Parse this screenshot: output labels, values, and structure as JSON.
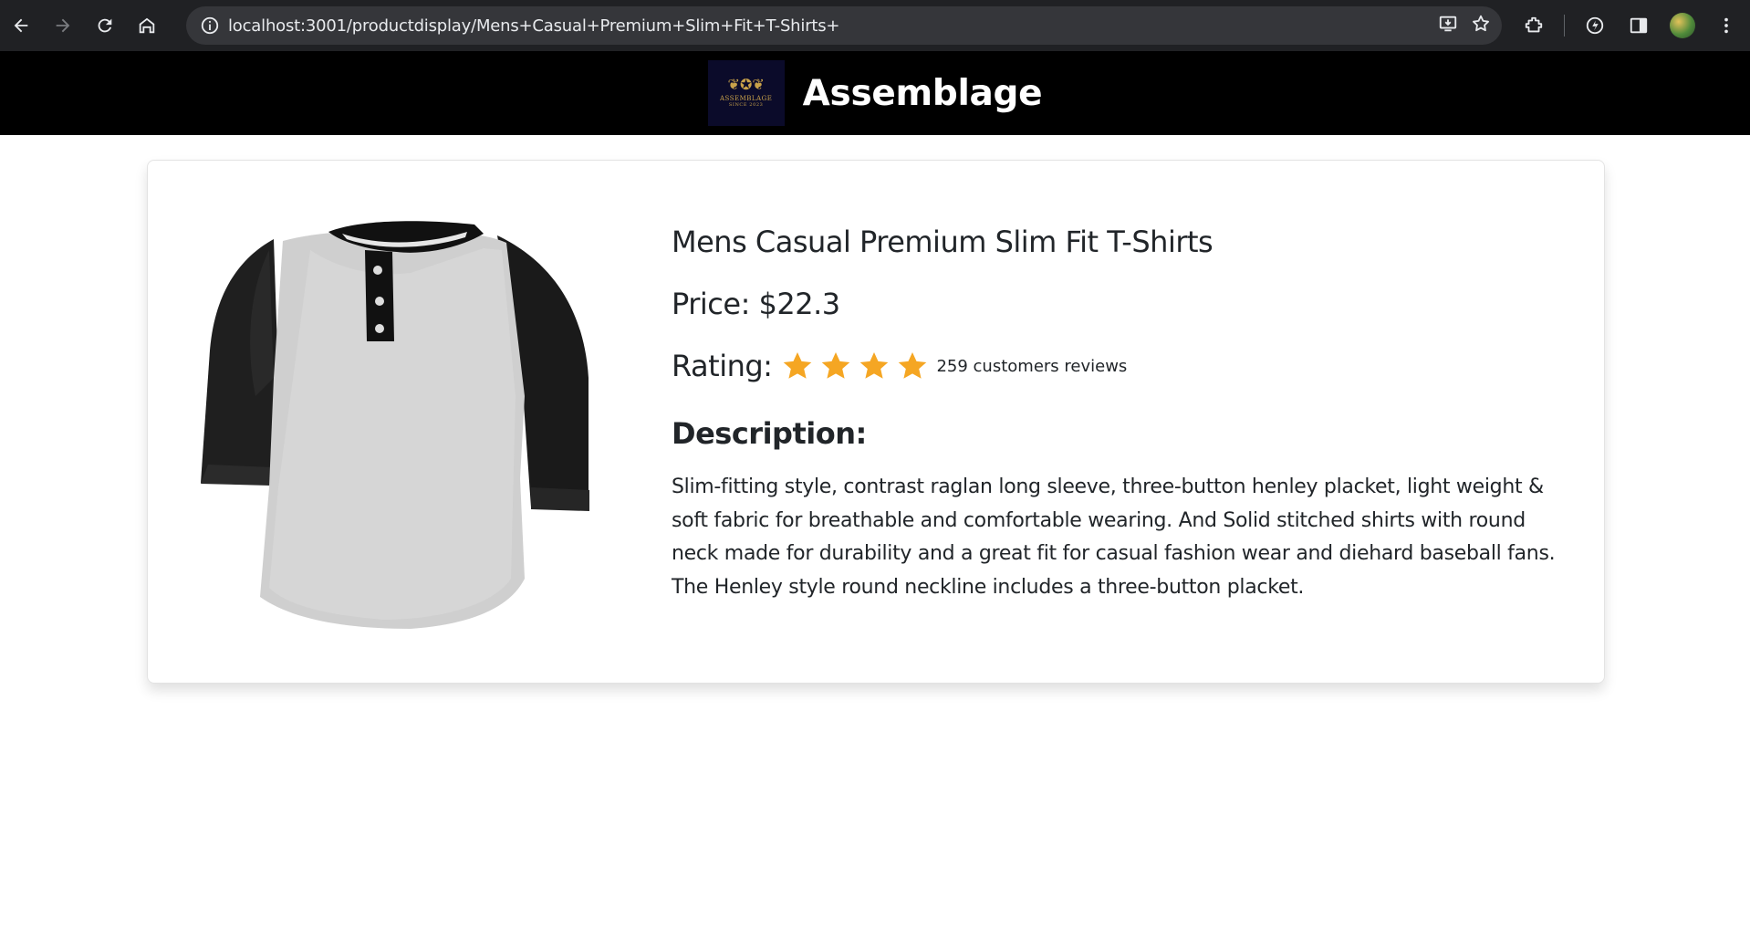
{
  "browser": {
    "url": "localhost:3001/productdisplay/Mens+Casual+Premium+Slim+Fit+T-Shirts+"
  },
  "header": {
    "brand_name": "Assemblage",
    "logo": {
      "name": "ASSEMBLAGE",
      "since": "SINCE 2023"
    }
  },
  "product": {
    "title": "Mens Casual Premium Slim Fit T-Shirts",
    "price_label": "Price: ",
    "price_value": "$22.3",
    "rating_label": "Rating:",
    "stars_shown": 4,
    "reviews_text": "259 customers reviews",
    "description_heading": "Description:",
    "description": "Slim-fitting style, contrast raglan long sleeve, three-button henley placket, light weight & soft fabric for breathable and comfortable wearing. And Solid stitched shirts with round neck made for durability and a great fit for casual fashion wear and diehard baseball fans. The Henley style round neckline includes a three-button placket."
  },
  "colors": {
    "star": "#f5a623",
    "header_bg": "#000000",
    "chrome_bg": "#202124"
  }
}
